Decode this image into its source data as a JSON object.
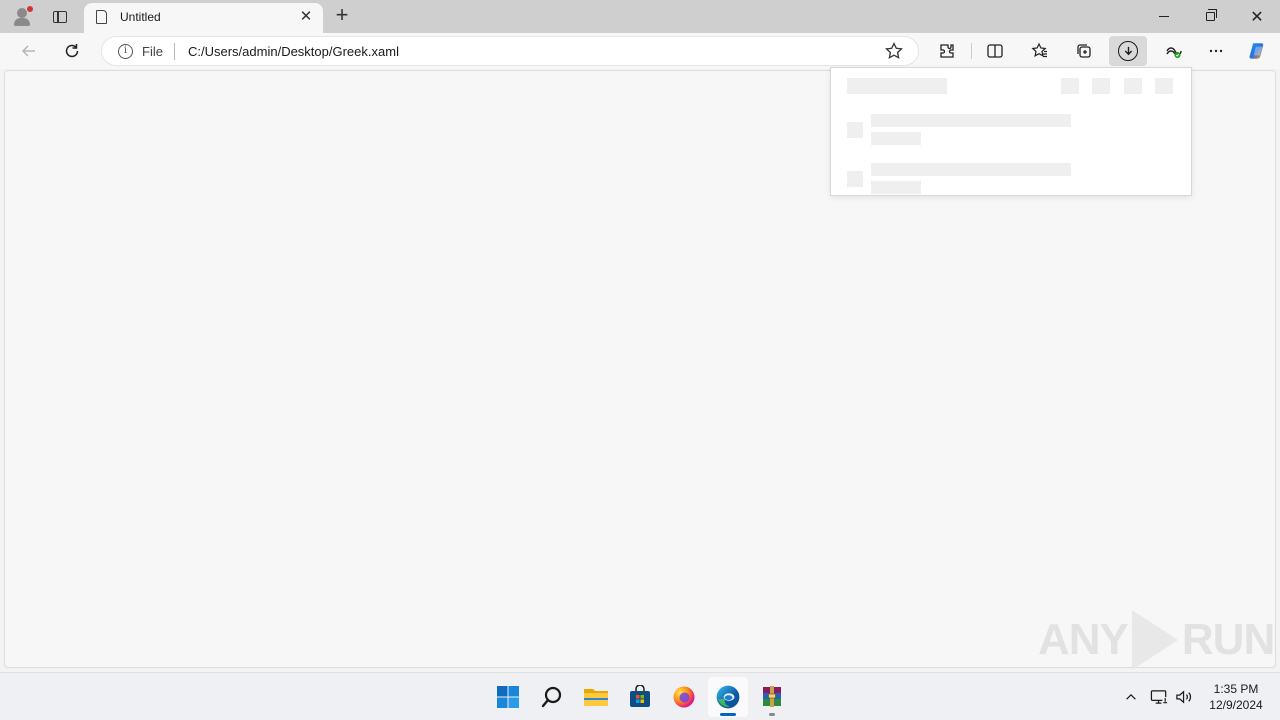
{
  "browser": {
    "tab": {
      "title": "Untitled"
    },
    "address_bar": {
      "scheme_label": "File",
      "url": "C:/Users/admin/Desktop/Greek.xaml"
    }
  },
  "toolbar": {
    "icons": [
      "back-arrow-icon",
      "refresh-icon",
      "info-icon",
      "star-icon",
      "extensions-icon",
      "split-screen-icon",
      "favorites-icon",
      "collections-icon",
      "downloads-icon",
      "performance-icon",
      "more-icon",
      "copilot-icon"
    ]
  },
  "downloads_flyout": {
    "state": "loading"
  },
  "watermark": {
    "left": "ANY",
    "right": "RUN"
  },
  "taskbar": {
    "apps": [
      "start",
      "search",
      "file-explorer",
      "microsoft-store",
      "firefox",
      "edge",
      "winrar"
    ],
    "active_app": "edge"
  },
  "clock": {
    "time": "1:35 PM",
    "date": "12/9/2024"
  },
  "colors": {
    "accent": "#0067c0",
    "tab_strip": "#cfcfcf",
    "page_bg": "#f7f7f7"
  }
}
